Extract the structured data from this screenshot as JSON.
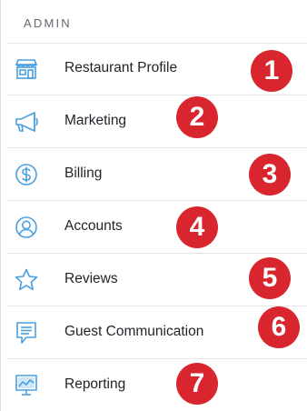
{
  "sidebar": {
    "section_title": "ADMIN",
    "items": [
      {
        "label": "Restaurant Profile",
        "icon": "storefront-icon"
      },
      {
        "label": "Marketing",
        "icon": "megaphone-icon"
      },
      {
        "label": "Billing",
        "icon": "dollar-circle-icon"
      },
      {
        "label": "Accounts",
        "icon": "user-circle-icon"
      },
      {
        "label": "Reviews",
        "icon": "star-icon"
      },
      {
        "label": "Guest Communication",
        "icon": "chat-bubble-icon"
      },
      {
        "label": "Reporting",
        "icon": "chart-monitor-icon"
      }
    ]
  },
  "badges": [
    "1",
    "2",
    "3",
    "4",
    "5",
    "6",
    "7"
  ],
  "colors": {
    "icon": "#4a9fe0",
    "badge": "#d9262e",
    "label": "#1f2328",
    "divider": "#e4e6ea",
    "header": "#5f6770"
  }
}
